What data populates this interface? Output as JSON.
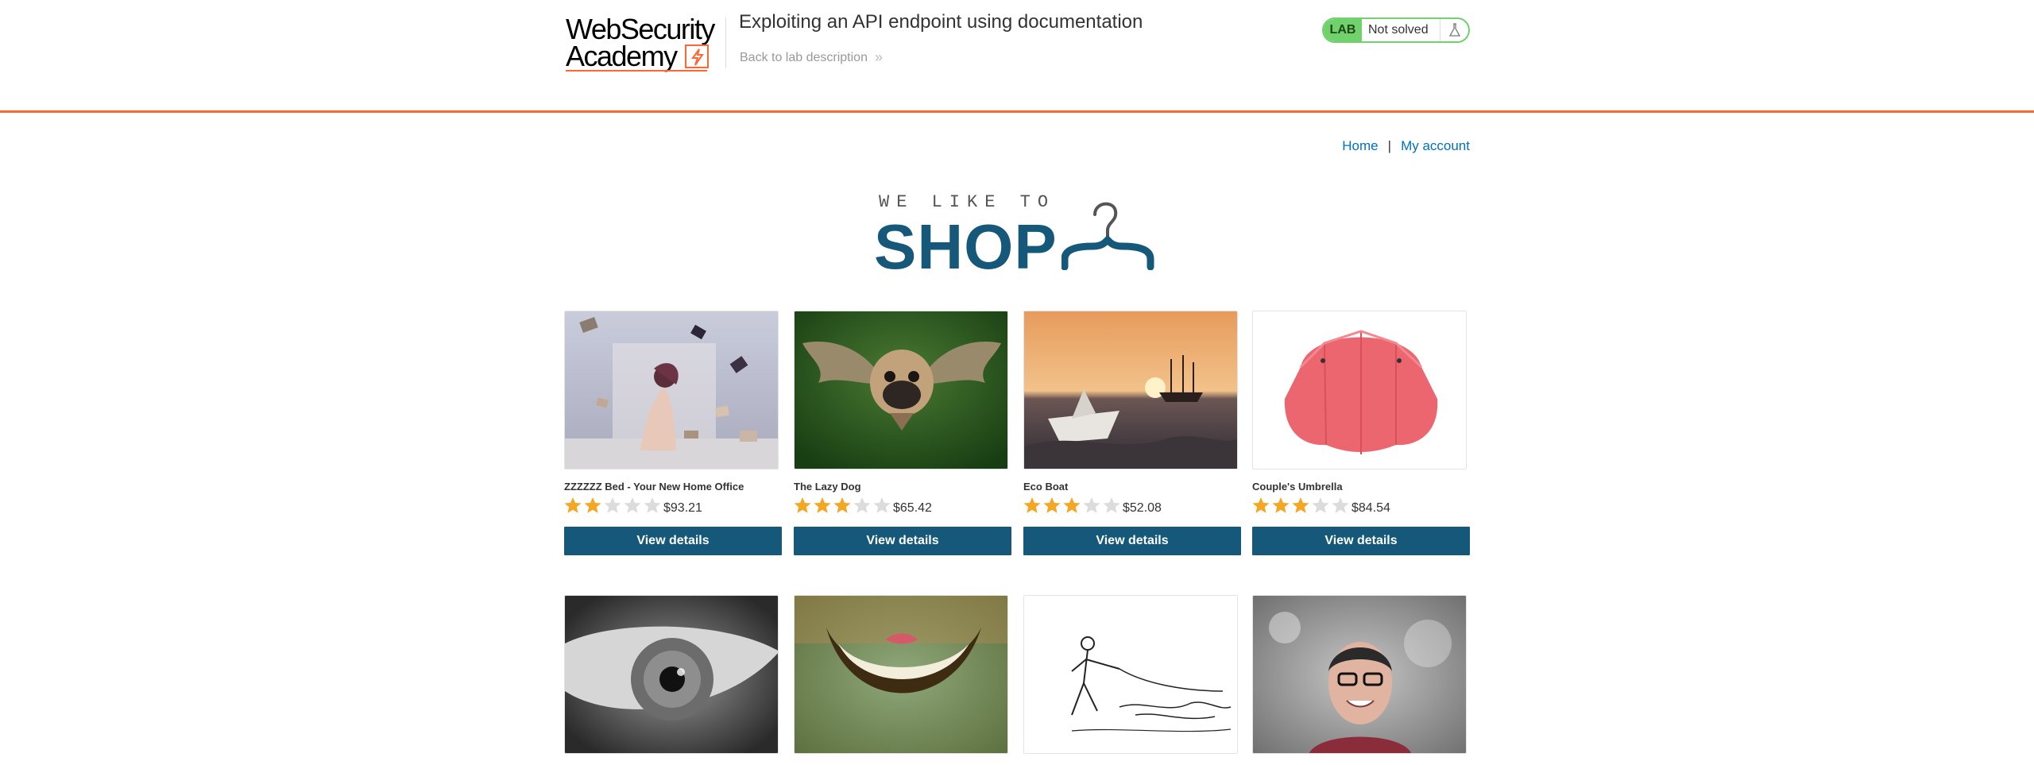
{
  "header": {
    "logo_line1": "WebSecurity",
    "logo_line2": "Academy",
    "lab_title": "Exploiting an API endpoint using documentation",
    "back_link": "Back to lab description",
    "lab_badge": "LAB",
    "lab_status": "Not solved"
  },
  "nav": {
    "home": "Home",
    "separator": "|",
    "account": "My account"
  },
  "banner": {
    "small": "WE LIKE TO",
    "big": "SHOP"
  },
  "colors": {
    "accent": "#ff6633",
    "primary": "#15587a",
    "link": "#0071bc",
    "lab_green": "#70d16d",
    "star": "#f5a623",
    "star_empty": "#dcdcdc"
  },
  "products": [
    {
      "name": "ZZZZZZ Bed - Your New Home Office",
      "rating": 2,
      "price": "$93.21",
      "button": "View details",
      "image": "woman-on-bed-with-flying-books"
    },
    {
      "name": "The Lazy Dog",
      "rating": 3,
      "price": "$65.42",
      "button": "View details",
      "image": "pug-with-wings"
    },
    {
      "name": "Eco Boat",
      "rating": 3,
      "price": "$52.08",
      "button": "View details",
      "image": "paper-boat-at-sunset"
    },
    {
      "name": "Couple's Umbrella",
      "rating": 3,
      "price": "$84.54",
      "button": "View details",
      "image": "red-umbrella"
    },
    {
      "name": "",
      "rating": 0,
      "price": "",
      "button": "",
      "image": "eye-closeup"
    },
    {
      "name": "",
      "rating": 0,
      "price": "",
      "button": "",
      "image": "cheshire-grin"
    },
    {
      "name": "",
      "rating": 0,
      "price": "",
      "button": "",
      "image": "sketch-man-walking-dogs"
    },
    {
      "name": "",
      "rating": 0,
      "price": "",
      "button": "",
      "image": "person-splashed-with-water"
    }
  ]
}
